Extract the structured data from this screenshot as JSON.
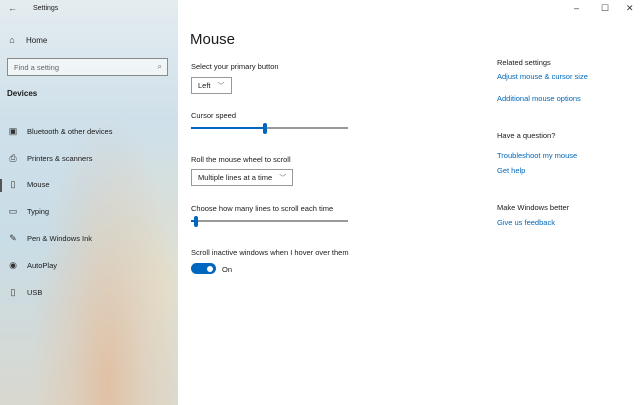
{
  "window": {
    "title": "Settings",
    "back_icon": "back-arrow-icon"
  },
  "sidebar": {
    "home": "Home",
    "search_placeholder": "Find a setting",
    "section": "Devices",
    "items": [
      {
        "label": "Bluetooth & other devices",
        "icon": "bluetooth-devices-icon"
      },
      {
        "label": "Printers & scanners",
        "icon": "printer-icon"
      },
      {
        "label": "Mouse",
        "icon": "mouse-icon",
        "selected": true
      },
      {
        "label": "Typing",
        "icon": "keyboard-icon"
      },
      {
        "label": "Pen & Windows Ink",
        "icon": "pen-icon"
      },
      {
        "label": "AutoPlay",
        "icon": "autoplay-icon"
      },
      {
        "label": "USB",
        "icon": "usb-icon"
      }
    ]
  },
  "main": {
    "title": "Mouse",
    "primary_button_label": "Select your primary button",
    "primary_button_value": "Left",
    "cursor_speed_label": "Cursor speed",
    "cursor_speed_fraction": 0.47,
    "wheel_label": "Roll the mouse wheel to scroll",
    "wheel_value": "Multiple lines at a time",
    "lines_label": "Choose how many lines to scroll each time",
    "lines_fraction": 0.03,
    "inactive_label": "Scroll inactive windows when I hover over them",
    "inactive_state": "On"
  },
  "related": {
    "heading": "Related settings",
    "link1": "Adjust mouse & cursor size",
    "link2": "Additional mouse options",
    "question_heading": "Have a question?",
    "link3": "Troubleshoot my mouse",
    "link4": "Get help",
    "better_heading": "Make Windows better",
    "link5": "Give us feedback"
  },
  "colors": {
    "accent": "#0067c0",
    "link": "#0067b8"
  }
}
